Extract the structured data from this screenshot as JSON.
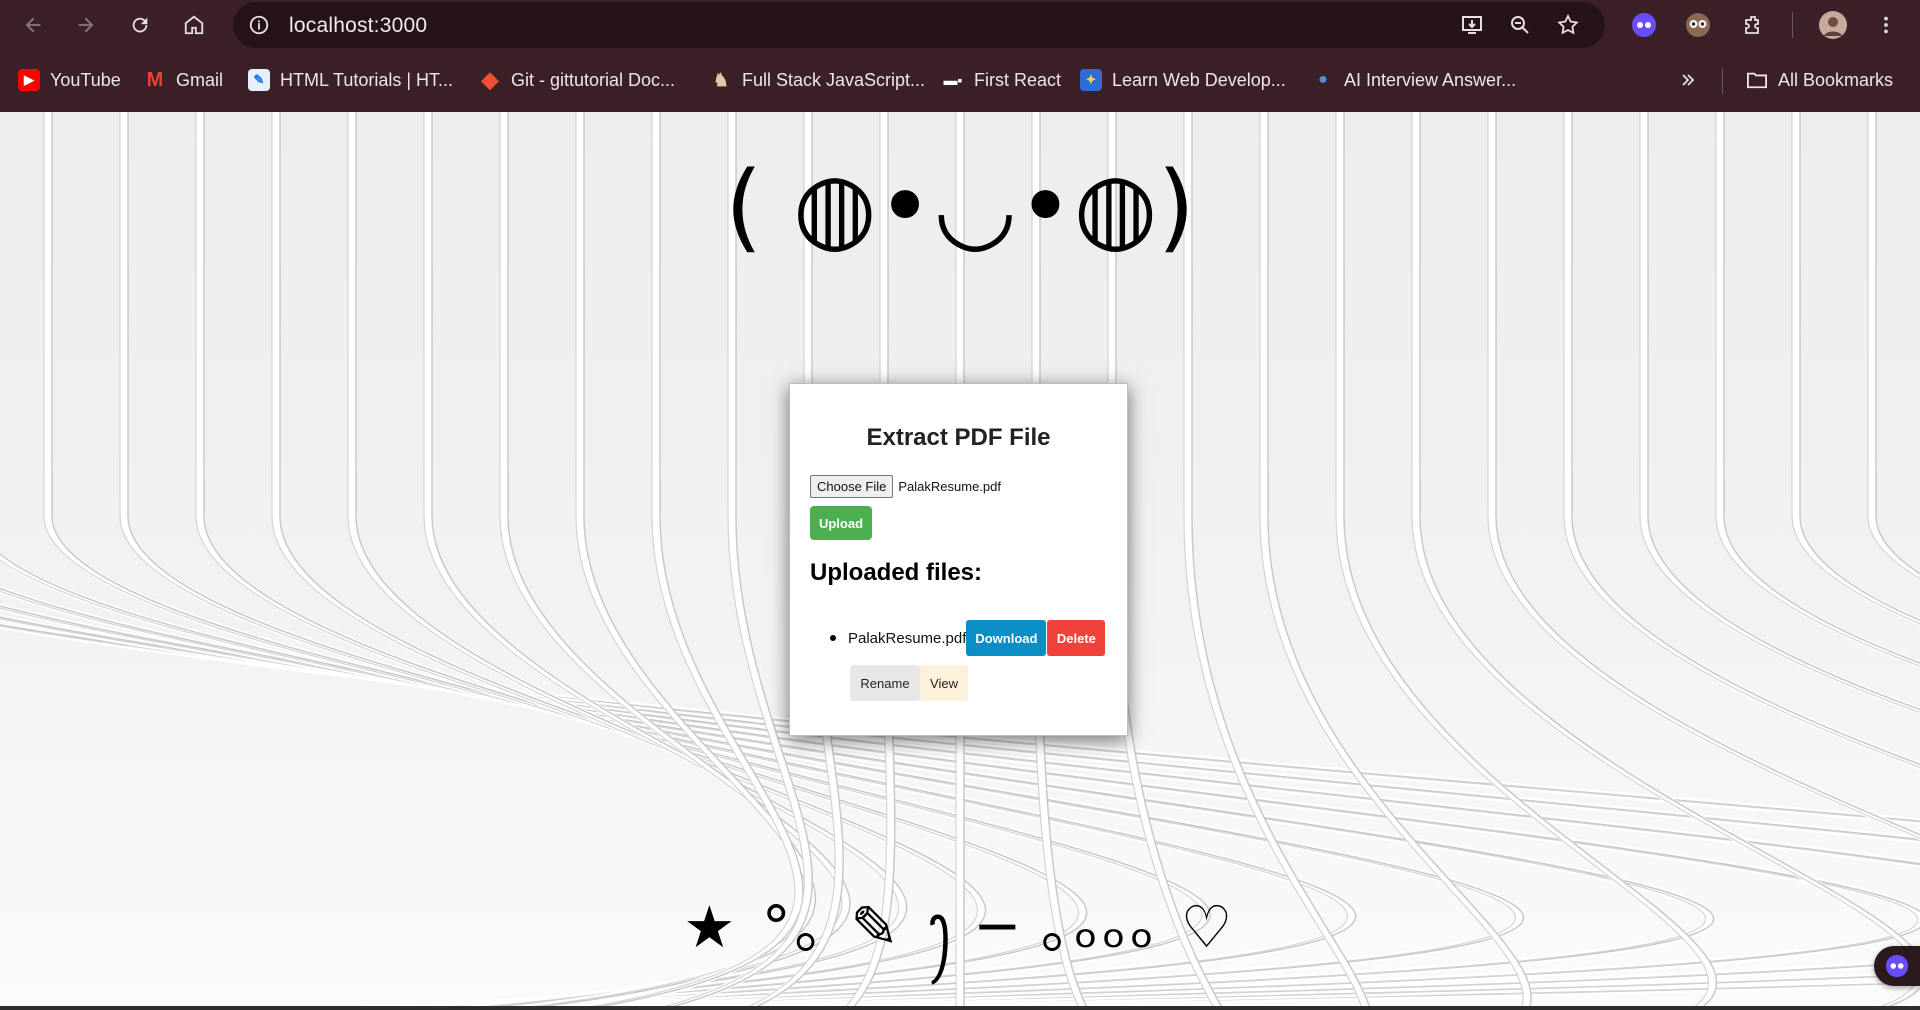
{
  "browser": {
    "url": "localhost:3000",
    "bookmarks": [
      {
        "label": "YouTube",
        "icon": "youtube-icon"
      },
      {
        "label": "Gmail",
        "icon": "gmail-icon"
      },
      {
        "label": "HTML Tutorials | HT...",
        "icon": "html-tutorials-icon"
      },
      {
        "label": "Git - gittutorial Doc...",
        "icon": "git-icon"
      },
      {
        "label": "Full Stack JavaScript...",
        "icon": "fullstack-icon"
      },
      {
        "label": "First React",
        "icon": "react-icon"
      },
      {
        "label": "Learn Web Develop...",
        "icon": "learn-web-icon"
      },
      {
        "label": "AI Interview Answer...",
        "icon": "ai-interview-icon"
      }
    ],
    "all_bookmarks_label": "All Bookmarks"
  },
  "page": {
    "kaomoji": "( ◍•◡•◍)",
    "doodle": "★ °｡ ✎ ꫂ ─ ｡ₒₒₒ ♡"
  },
  "card": {
    "title": "Extract PDF File",
    "choose_file_label": "Choose File",
    "chosen_file": "PalakResume.pdf",
    "upload_label": "Upload",
    "uploaded_title": "Uploaded files:",
    "files": [
      {
        "name": "PalakResume.pdf",
        "download_label": "Download",
        "delete_label": "Delete",
        "rename_label": "Rename",
        "view_label": "View"
      }
    ]
  },
  "colors": {
    "chrome_bg": "#3b2028",
    "upload": "#4caf50",
    "download": "#0b8ec4",
    "delete": "#f0423a",
    "rename": "#e7e7e7",
    "view": "#fdf1dc"
  }
}
